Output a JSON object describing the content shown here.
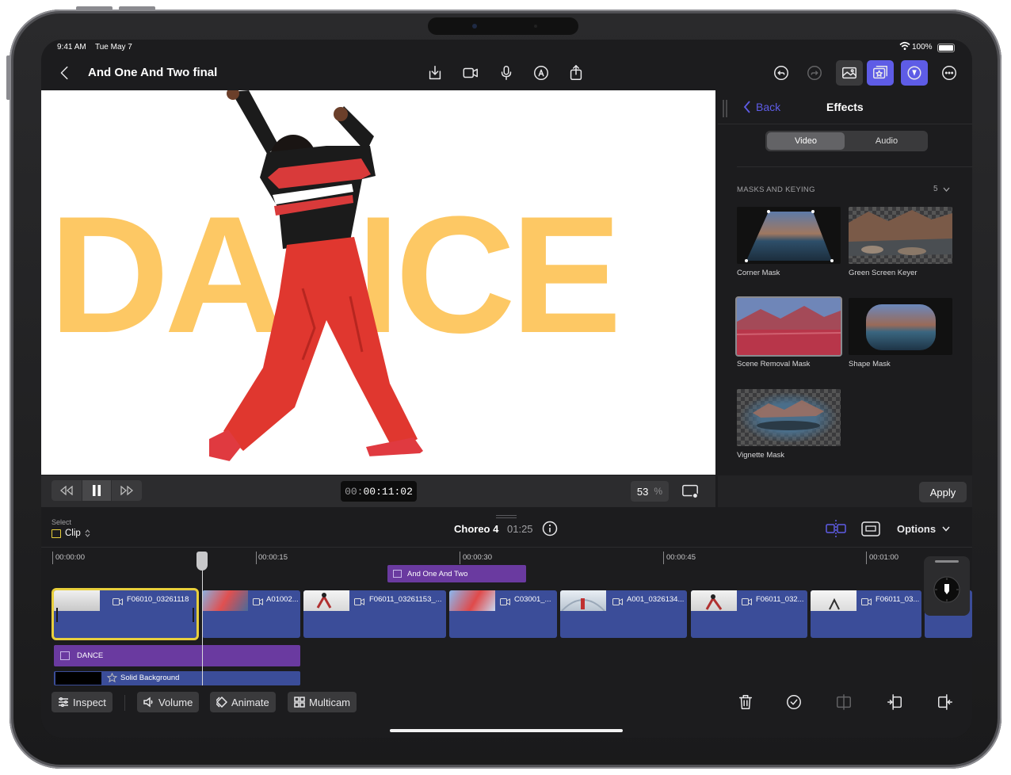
{
  "status": {
    "time": "9:41 AM",
    "date": "Tue May 7",
    "battery": "100%"
  },
  "project": {
    "title": "And One And Two final"
  },
  "viewer": {
    "overlay_text": "DANCE",
    "timecode_dim": "00:",
    "timecode": "00:11:02",
    "zoom": "53",
    "zoom_unit": "%"
  },
  "inspector": {
    "back_label": "Back",
    "title": "Effects",
    "tabs": [
      "Video",
      "Audio"
    ],
    "selected_tab": "Video",
    "section_title": "MASKS AND KEYING",
    "section_count": "5",
    "effects": [
      "Corner Mask",
      "Green Screen Keyer",
      "Scene Removal Mask",
      "Shape Mask",
      "Vignette Mask"
    ],
    "selected_effect": "Scene Removal Mask",
    "apply_label": "Apply"
  },
  "timeline": {
    "select_label": "Select",
    "select_mode": "Clip",
    "project_name": "Choreo 4",
    "duration": "01:25",
    "options_label": "Options",
    "ruler": [
      "00:00:00",
      "00:00:15",
      "00:00:30",
      "00:00:45",
      "00:01:00"
    ],
    "connected_title": "And One And Two",
    "clips": [
      "F06010_03261118",
      "A01002...",
      "F06011_03261153_...",
      "C03001_...",
      "A001_0326134...",
      "F06011_032...",
      "F06011_03..."
    ],
    "title_clip": "DANCE",
    "generator_clip": "Solid Background"
  },
  "toolbar": {
    "inspect": "Inspect",
    "volume": "Volume",
    "animate": "Animate",
    "multicam": "Multicam"
  },
  "colors": {
    "accent": "#5e5ce6",
    "clip_blue": "#3b4d99",
    "title_purple": "#6a3aa0",
    "dance_yellow": "#fdc864",
    "select_yellow": "#e8cf3c"
  }
}
